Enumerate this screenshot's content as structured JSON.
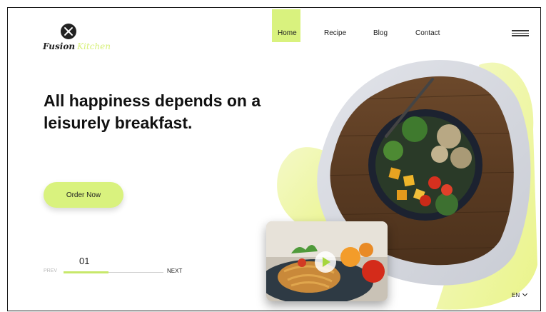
{
  "logo": {
    "mark_icon": "close-circle-icon",
    "text_primary": "Fusion",
    "text_accent": "Kitchen"
  },
  "nav": {
    "items": [
      {
        "label": "Home",
        "active": true
      },
      {
        "label": "Recipe",
        "active": false
      },
      {
        "label": "Blog",
        "active": false
      },
      {
        "label": "Contact",
        "active": false
      }
    ],
    "menu_icon": "hamburger-icon"
  },
  "hero": {
    "headline_line1": "All happiness depends on a",
    "headline_line2": "leisurely breakfast.",
    "cta_label": "Order Now"
  },
  "slider": {
    "current": "01",
    "prev_label": "PREV",
    "next_label": "NEXT",
    "progress": 0.45
  },
  "video": {
    "play_icon": "play-icon"
  },
  "language": {
    "label": "EN",
    "icon": "chevron-down-icon"
  },
  "colors": {
    "accent": "#d9f27e",
    "accent_deep": "#c7e86a",
    "text": "#111111"
  }
}
